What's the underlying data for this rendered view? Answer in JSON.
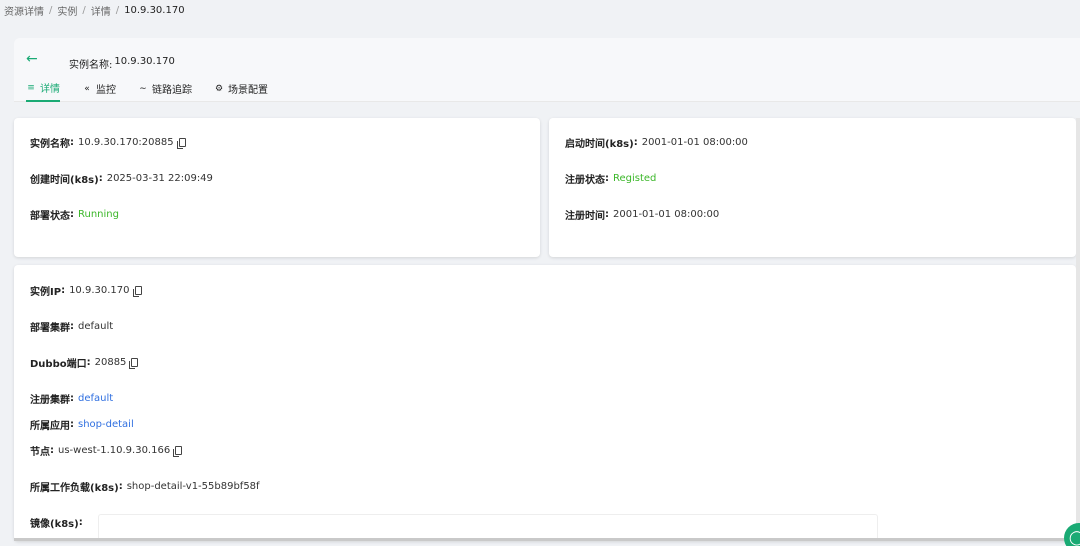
{
  "breadcrumb": [
    {
      "label": "资源详情"
    },
    {
      "label": "实例"
    },
    {
      "label": "详情"
    },
    {
      "label": "10.9.30.170"
    }
  ],
  "header": {
    "title_label": "实例名称:",
    "title_value": "10.9.30.170"
  },
  "tabs": [
    {
      "label": "详情",
      "icon": "list-icon",
      "active": true
    },
    {
      "label": "监控",
      "icon": "code-icon",
      "active": false
    },
    {
      "label": "链路追踪",
      "icon": "trace-icon",
      "active": false
    },
    {
      "label": "场景配置",
      "icon": "gear-icon",
      "active": false
    }
  ],
  "card_left": {
    "fields": [
      {
        "label": "实例名称",
        "value": "10.9.30.170:20885",
        "copy": true
      },
      {
        "label": "创建时间(k8s)",
        "value": "2025-03-31 22:09:49"
      },
      {
        "label": "部署状态",
        "value": "Running",
        "status_color": "#3cb72a"
      }
    ]
  },
  "card_right": {
    "fields": [
      {
        "label": "启动时间(k8s)",
        "value": "2001-01-01 08:00:00"
      },
      {
        "label": "注册状态",
        "value": "Registed",
        "status_color": "#3cb72a"
      },
      {
        "label": "注册时间",
        "value": "2001-01-01 08:00:00"
      }
    ]
  },
  "card_bottom": {
    "fields": [
      {
        "label": "实例IP",
        "value": "10.9.30.170",
        "copy": true
      },
      {
        "label": "部署集群",
        "value": "default"
      },
      {
        "label": "Dubbo端口",
        "value": "20885",
        "copy": true
      },
      {
        "label": "注册集群",
        "value": "default",
        "link": true
      },
      {
        "label": "所属应用",
        "value": "shop-detail",
        "link": true
      },
      {
        "label": "节点",
        "value": "us-west-1.10.9.30.166",
        "copy": true
      },
      {
        "label": "所属工作负载(k8s)",
        "value": "shop-detail-v1-55b89bf58f"
      },
      {
        "label": "镜像(k8s)",
        "value": ""
      }
    ]
  },
  "colors": {
    "accent": "#1aaa74",
    "status_green": "#3cb72a",
    "link_blue": "#2f6fe0"
  }
}
